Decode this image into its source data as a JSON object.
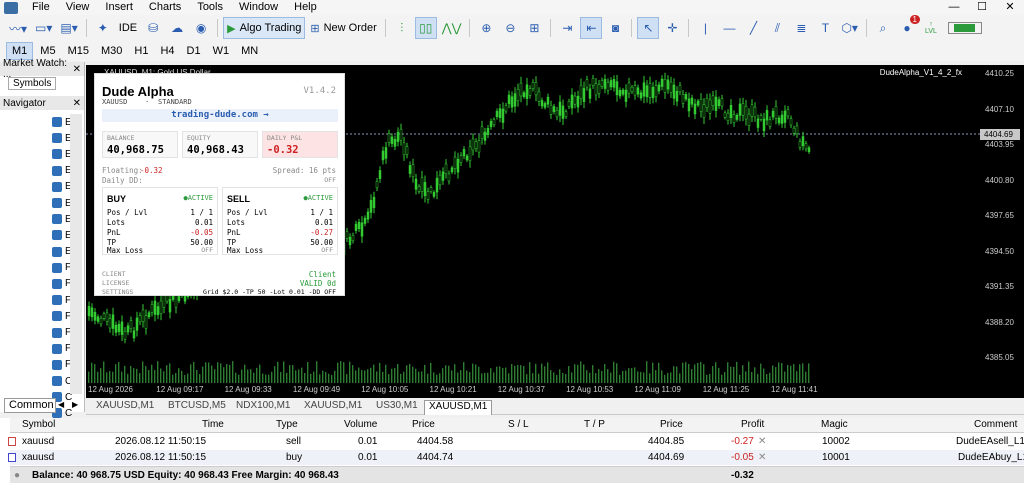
{
  "menu": {
    "items": [
      "File",
      "View",
      "Insert",
      "Charts",
      "Tools",
      "Window",
      "Help"
    ]
  },
  "window": {
    "controls": [
      "—",
      "☐",
      "✕"
    ]
  },
  "toolbar": {
    "ide_label": "IDE",
    "algo_label": "Algo Trading",
    "new_order_label": "New Order",
    "notification_count": "1",
    "lvl_label": "LVL"
  },
  "timeframes": [
    "M1",
    "M5",
    "M15",
    "M30",
    "H1",
    "H4",
    "D1",
    "W1",
    "MN"
  ],
  "left_panel": {
    "market_watch_title": "Market Watch: ...",
    "symbols_tab": "Symbols",
    "navigator_title": "Navigator",
    "nav_items": [
      "E",
      "E",
      "E",
      "E",
      "E",
      "E",
      "E",
      "E",
      "E",
      "F",
      "F",
      "F",
      "F",
      "F",
      "F",
      "F",
      "C",
      "C",
      "C"
    ],
    "common_tab": "Common"
  },
  "chart": {
    "title": "XAUUSD, M1:  Gold US Dollar",
    "ea_title": "DudeAlpha_V1_4_2_fx",
    "current_price": "4404.69",
    "price_labels": [
      "4410.25",
      "4407.10",
      "4403.95",
      "4400.80",
      "4397.65",
      "4394.50",
      "4391.35",
      "4388.20",
      "4385.05"
    ],
    "time_labels": [
      "12 Aug 2026",
      "12 Aug 09:17",
      "12 Aug 09:33",
      "12 Aug 09:49",
      "12 Aug 10:05",
      "12 Aug 10:21",
      "12 Aug 10:37",
      "12 Aug 10:53",
      "12 Aug 11:09",
      "12 Aug 11:25",
      "12 Aug 11:41"
    ]
  },
  "ea_panel": {
    "name": "Dude Alpha",
    "version": "V1.4.2",
    "symbol": "XAUUSD",
    "dot": "·",
    "account_type": "STANDARD",
    "link": "trading-dude.com  →",
    "balance_label": "BALANCE",
    "balance_value": "40,968.75",
    "equity_label": "EQUITY",
    "equity_value": "40,968.43",
    "daily_pnl_label": "DAILY P&L",
    "daily_pnl_value": "-0.32",
    "floating_label": "Floating:",
    "floating_value": "-0.32",
    "spread_label": "Spread: 16 pts",
    "daily_dd_label": "Daily DD:",
    "daily_dd_value": "OFF",
    "buy": {
      "title": "BUY",
      "status": "●ACTIVE",
      "pos_label": "Pos / Lvl",
      "pos_value": "1 / 1",
      "lots_label": "Lots",
      "lots_value": "0.01",
      "pnl_label": "PnL",
      "pnl_value": "-0.05",
      "tp_label": "TP",
      "tp_value": "50.00",
      "maxloss_label": "Max Loss",
      "maxloss_value": "OFF"
    },
    "sell": {
      "title": "SELL",
      "status": "●ACTIVE",
      "pos_label": "Pos / Lvl",
      "pos_value": "1 / 1",
      "lots_label": "Lots",
      "lots_value": "0.01",
      "pnl_label": "PnL",
      "pnl_value": "-0.27",
      "tp_label": "TP",
      "tp_value": "50.00",
      "maxloss_label": "Max Loss",
      "maxloss_value": "OFF"
    },
    "client_label": "CLIENT",
    "client_value": "Client",
    "license_label": "LICENSE",
    "license_value": "VALID 0d",
    "settings_label": "SETTINGS",
    "settings_value": "Grid $2.0 -TP 50 -Lot 0.01 -DD OFF"
  },
  "chart_tabs": [
    "XAUUSD,M1",
    "BTCUSD,M5",
    "NDX100,M1",
    "XAUUSD,M1",
    "US30,M1",
    "XAUUSD,M1"
  ],
  "trade_table": {
    "headers": [
      "Symbol",
      "Time",
      "Type",
      "Volume",
      "Price",
      "S / L",
      "T / P",
      "Price",
      "Profit",
      "Magic",
      "Comment"
    ],
    "rows": [
      [
        "xauusd",
        "2026.08.12 11:50:15",
        "sell",
        "0.01",
        "4404.58",
        "",
        "",
        "4404.85",
        "-0.27",
        "10002",
        "DudeEAsell_L1"
      ],
      [
        "xauusd",
        "2026.08.12 11:50:15",
        "buy",
        "0.01",
        "4404.74",
        "",
        "",
        "4404.69",
        "-0.05",
        "10001",
        "DudeEAbuy_L1"
      ]
    ],
    "balance_line": "Balance: 40 968.75 USD  Equity: 40 968.43  Free Margin: 40 968.43",
    "total_profit": "-0.32"
  },
  "colors": {
    "chart_bg": "#000000",
    "candle": "#33cc33",
    "bid_line": "#8899bb",
    "loss": "#cc2222",
    "active": "#2a9a3a"
  }
}
